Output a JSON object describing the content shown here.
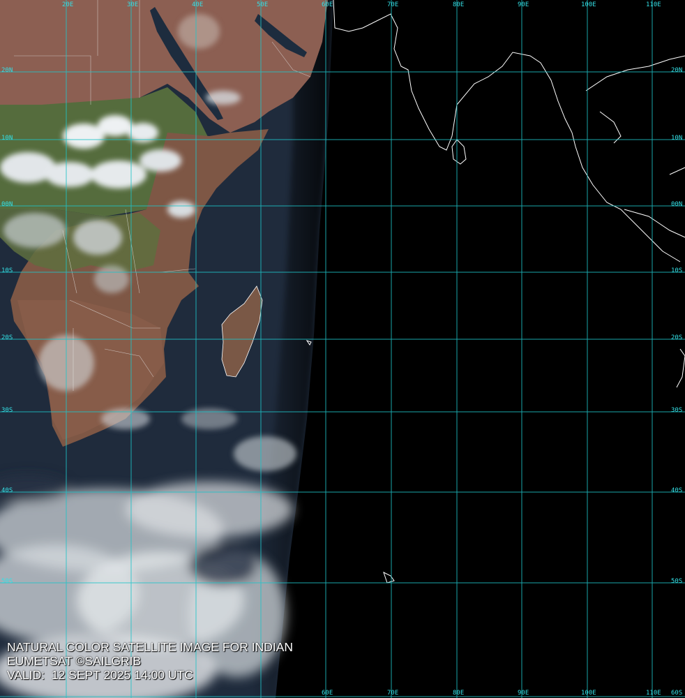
{
  "map": {
    "caption": {
      "line1": "NATURAL COLOR SATELLITE IMAGE FOR INDIAN",
      "line2": "EUMETSAT ©SAILGRIB",
      "line3": "VALID:  12 SEPT 2025 14:00 UTC"
    },
    "longitude_labels": [
      "20E",
      "30E",
      "40E",
      "50E",
      "60E",
      "70E",
      "80E",
      "90E",
      "100E",
      "110E"
    ],
    "latitude_labels": [
      "20N",
      "10N",
      "00N",
      "10S",
      "20S",
      "30S",
      "40S",
      "50S",
      "60S"
    ],
    "colors": {
      "grid": "#1fc3c8",
      "label": "#34e0e6",
      "night": "#000000",
      "ocean": "#1d2a3a",
      "land": "#8a5a48",
      "vegetation": "#4f6a3a",
      "cloud": "#e8ecef",
      "coastline": "#ffffff"
    }
  }
}
